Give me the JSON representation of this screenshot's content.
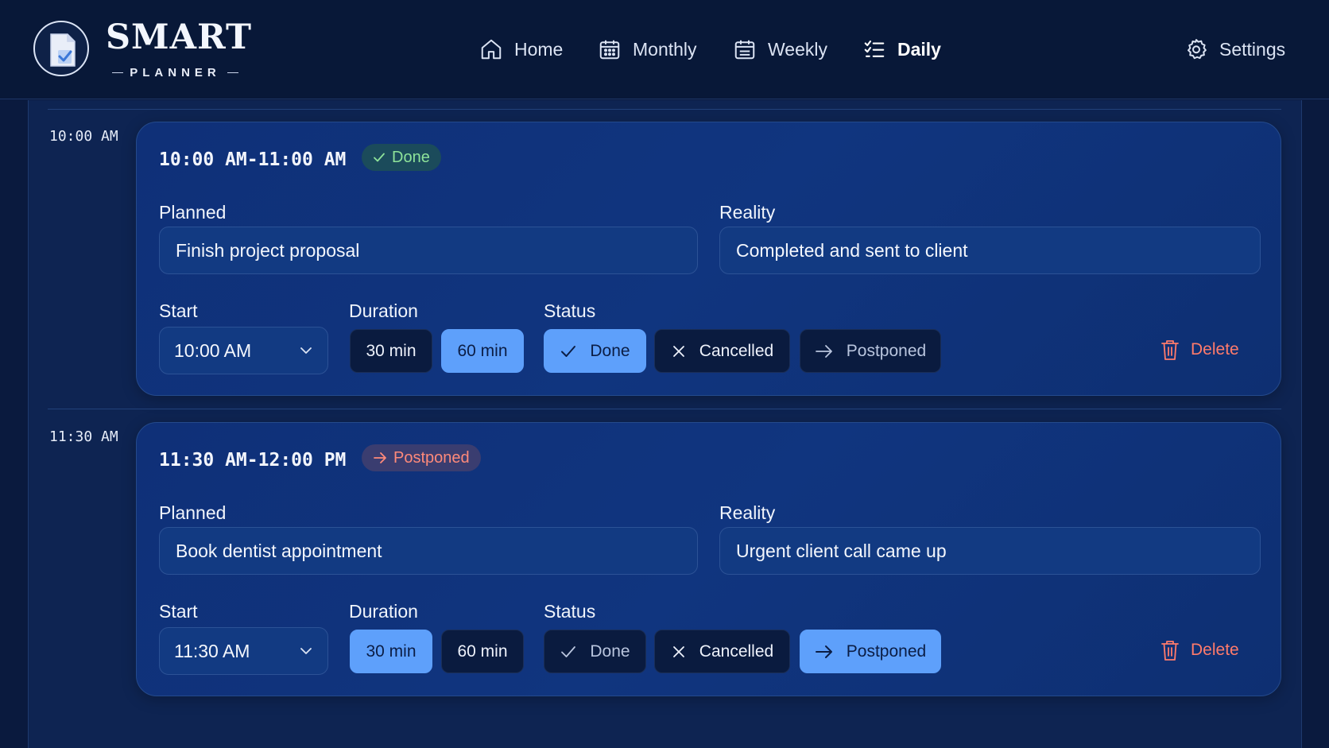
{
  "brand": {
    "title": "SMART",
    "subtitle": "PLANNER"
  },
  "nav": [
    {
      "label": "Home",
      "icon": "home-icon"
    },
    {
      "label": "Monthly",
      "icon": "calendar-icon"
    },
    {
      "label": "Weekly",
      "icon": "calendar-icon"
    },
    {
      "label": "Daily",
      "icon": "checklist-icon",
      "active": true
    },
    {
      "label": "Settings",
      "icon": "gear-icon"
    }
  ],
  "labels": {
    "planned": "Planned",
    "reality": "Reality",
    "start": "Start",
    "duration": "Duration",
    "status": "Status",
    "delete": "Delete",
    "done": "Done",
    "cancelled": "Cancelled",
    "postponed": "Postponed",
    "dur30": "30 min",
    "dur60": "60 min"
  },
  "entries": [
    {
      "slot": "10:00 AM",
      "range": "10:00 AM-11:00 AM",
      "badge": "Done",
      "planned": "Finish project proposal",
      "reality": "Completed and sent to client",
      "start": "10:00 AM",
      "duration_selected": "60 min",
      "status_selected": "Done"
    },
    {
      "slot": "11:30 AM",
      "range": "11:30 AM-12:00 PM",
      "badge": "Postponed",
      "planned": "Book dentist appointment",
      "reality": "Urgent client call came up",
      "start": "11:30 AM",
      "duration_selected": "30 min",
      "status_selected": "Postponed"
    }
  ],
  "colors": {
    "accent": "#5ea0fb",
    "done_badge_text": "#8ee39a",
    "postponed_badge_text": "#ff8a7a",
    "delete": "#ff7b6b"
  }
}
